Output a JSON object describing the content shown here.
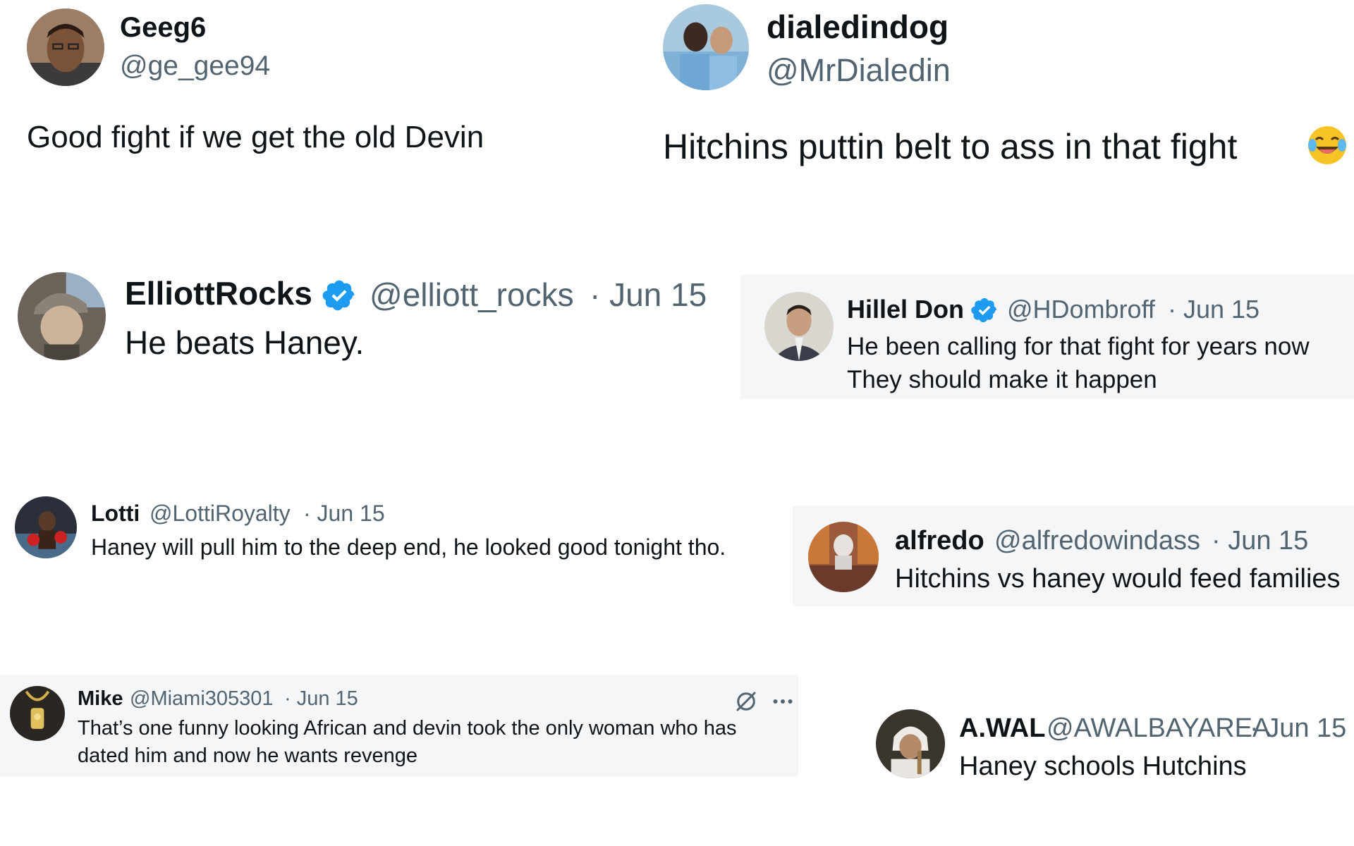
{
  "colors": {
    "verified": "#1d9bf0",
    "secondary_text": "#536471",
    "panel": "#f5f6f7",
    "emoji": "#f7c325"
  },
  "tweets": [
    {
      "name": "Geeg6",
      "handle": "@ge_gee94",
      "date": "",
      "text": [
        "Good fight if we get the old Devin"
      ],
      "verified": false,
      "emoji": ""
    },
    {
      "name": "dialedindog",
      "handle": "@MrDialedin",
      "date": "",
      "text": [
        "Hitchins puttin belt to ass in that fight"
      ],
      "verified": false,
      "emoji": "laughing-crying-emoji"
    },
    {
      "name": "ElliottRocks",
      "handle": "@elliott_rocks",
      "date": "· Jun 15",
      "text": [
        "He beats Haney."
      ],
      "verified": true,
      "emoji": ""
    },
    {
      "name": "Hillel Don",
      "handle": "@HDombroff",
      "date": "· Jun 15",
      "text": [
        "He been calling for that fight for years now",
        "They should make it happen"
      ],
      "verified": true,
      "emoji": ""
    },
    {
      "name": "Lotti",
      "handle": "@LottiRoyalty",
      "date": "· Jun 15",
      "text": [
        "Haney will pull him to the deep end, he looked good tonight tho."
      ],
      "verified": false,
      "emoji": ""
    },
    {
      "name": "alfredo",
      "handle": "@alfredowindass",
      "date": "· Jun 15",
      "text": [
        "Hitchins vs haney would feed families"
      ],
      "verified": false,
      "emoji": ""
    },
    {
      "name": "Mike",
      "handle": "@Miami305301",
      "date": "· Jun 15",
      "text": [
        "That’s one funny looking African and devin took the only woman who has",
        "dated him and now he wants revenge"
      ],
      "verified": false,
      "emoji": "",
      "actions": [
        "grok-icon",
        "more-icon"
      ]
    },
    {
      "name": "A.WAL",
      "handle": "@AWALBAYAREA",
      "date": "· Jun 15",
      "text": [
        "Haney schools Hutchins"
      ],
      "verified": false,
      "emoji": ""
    }
  ]
}
